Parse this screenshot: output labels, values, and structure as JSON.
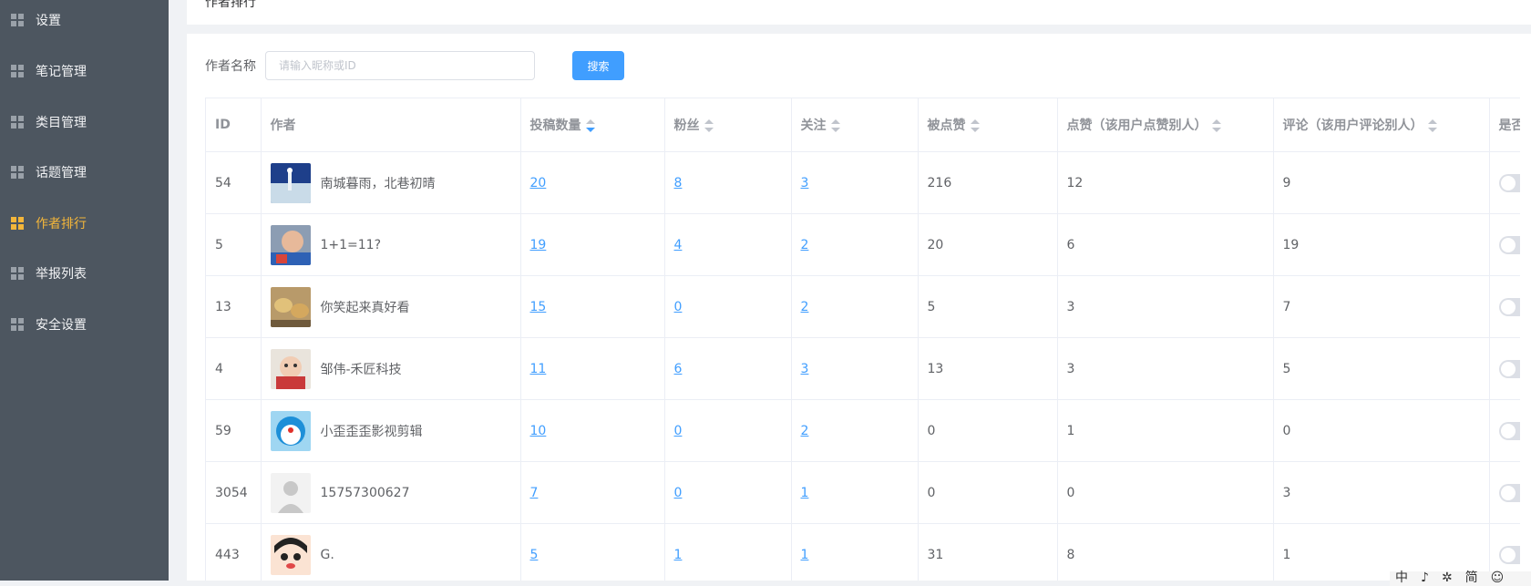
{
  "sidebar": {
    "items": [
      {
        "label": "设置",
        "active": false
      },
      {
        "label": "笔记管理",
        "active": false
      },
      {
        "label": "类目管理",
        "active": false
      },
      {
        "label": "话题管理",
        "active": false
      },
      {
        "label": "作者排行",
        "active": true
      },
      {
        "label": "举报列表",
        "active": false
      },
      {
        "label": "安全设置",
        "active": false
      }
    ]
  },
  "page": {
    "title": "作者排行"
  },
  "search": {
    "label": "作者名称",
    "placeholder": "请输入昵称或ID",
    "value": "",
    "button_label": "搜索"
  },
  "table": {
    "columns": [
      "ID",
      "作者",
      "投稿数量",
      "粉丝",
      "关注",
      "被点赞",
      "点赞（该用户点赞别人）",
      "评论（该用户评论别人）",
      "是否"
    ],
    "sorted_column": "投稿数量",
    "rows": [
      {
        "id": "54",
        "author": "南城暮雨，北巷初晴",
        "posts": "20",
        "fans": "8",
        "follows": "3",
        "liked": "216",
        "likes_given": "12",
        "comments": "9"
      },
      {
        "id": "5",
        "author": "1+1=11?",
        "posts": "19",
        "fans": "4",
        "follows": "2",
        "liked": "20",
        "likes_given": "6",
        "comments": "19"
      },
      {
        "id": "13",
        "author": "你笑起来真好看",
        "posts": "15",
        "fans": "0",
        "follows": "2",
        "liked": "5",
        "likes_given": "3",
        "comments": "7"
      },
      {
        "id": "4",
        "author": "邹伟-禾匠科技",
        "posts": "11",
        "fans": "6",
        "follows": "3",
        "liked": "13",
        "likes_given": "3",
        "comments": "5"
      },
      {
        "id": "59",
        "author": "小歪歪歪影视剪辑",
        "posts": "10",
        "fans": "0",
        "follows": "2",
        "liked": "0",
        "likes_given": "1",
        "comments": "0"
      },
      {
        "id": "3054",
        "author": "15757300627",
        "posts": "7",
        "fans": "0",
        "follows": "1",
        "liked": "0",
        "likes_given": "0",
        "comments": "3"
      },
      {
        "id": "443",
        "author": "G.",
        "posts": "5",
        "fans": "1",
        "follows": "1",
        "liked": "31",
        "likes_given": "8",
        "comments": "1"
      }
    ]
  },
  "ime": {
    "mode": "中",
    "punct": "♪",
    "skin": "✲",
    "simplified": "简",
    "emoji": "☺"
  },
  "colors": {
    "sidebar_bg": "#4d5660",
    "active": "#f4b63a",
    "primary": "#409eff"
  }
}
